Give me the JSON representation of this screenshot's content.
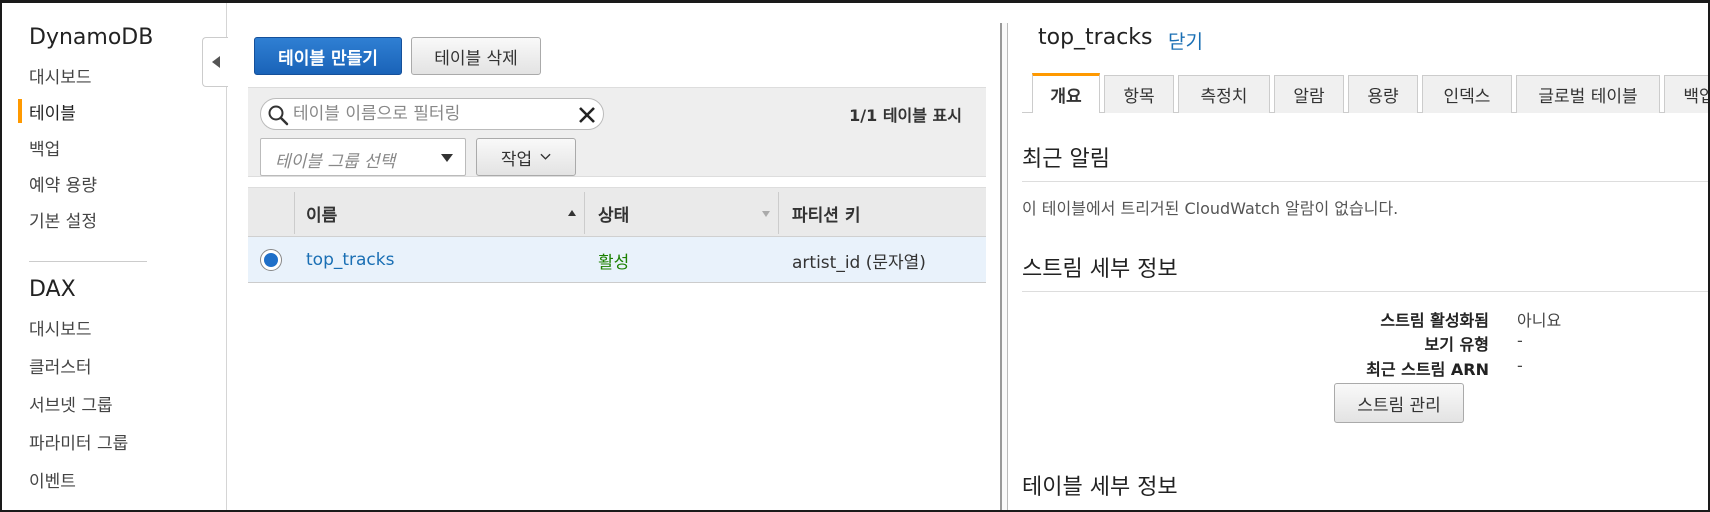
{
  "sidebar": {
    "dynamodb_title": "DynamoDB",
    "dynamodb_items": [
      {
        "label": "대시보드"
      },
      {
        "label": "테이블"
      },
      {
        "label": "백업"
      },
      {
        "label": "예약 용량"
      },
      {
        "label": "기본 설정"
      }
    ],
    "active_index": 1,
    "dax_title": "DAX",
    "dax_items": [
      {
        "label": "대시보드"
      },
      {
        "label": "클러스터"
      },
      {
        "label": "서브넷 그룹"
      },
      {
        "label": "파라미터 그룹"
      },
      {
        "label": "이벤트"
      }
    ]
  },
  "toolbar": {
    "create_label": "테이블 만들기",
    "delete_label": "테이블 삭제"
  },
  "filter": {
    "search_placeholder": "테이블 이름으로 필터링",
    "count_text": "1/1 테이블 표시",
    "group_placeholder": "테이블 그룹 선택",
    "action_label": "작업"
  },
  "table": {
    "columns": [
      "이름",
      "상태",
      "파티션 키"
    ],
    "rows": [
      {
        "name": "top_tracks",
        "status": "활성",
        "partition_key": "artist_id (문자열)",
        "selected": true
      }
    ]
  },
  "details": {
    "title": "top_tracks",
    "close_label": "닫기",
    "tabs": [
      "개요",
      "항목",
      "측정치",
      "알람",
      "용량",
      "인덱스",
      "글로벌 테이블",
      "백업"
    ],
    "active_tab": 0,
    "recent_alerts_heading": "최근 알림",
    "no_alarms_text": "이 테이블에서 트리거된 CloudWatch 알람이 없습니다.",
    "stream_heading": "스트림 세부 정보",
    "stream_fields": [
      {
        "label": "스트림 활성화됨",
        "value": "아니요"
      },
      {
        "label": "보기 유형",
        "value": "-"
      },
      {
        "label": "최근 스트림 ARN",
        "value": "-"
      }
    ],
    "manage_stream_label": "스트림 관리",
    "table_details_heading": "테이블 세부 정보"
  },
  "colors": {
    "primary_button": "#1f6fc8",
    "link": "#1a6fb4",
    "status_active": "#1d8102",
    "accent": "#ff9900"
  }
}
